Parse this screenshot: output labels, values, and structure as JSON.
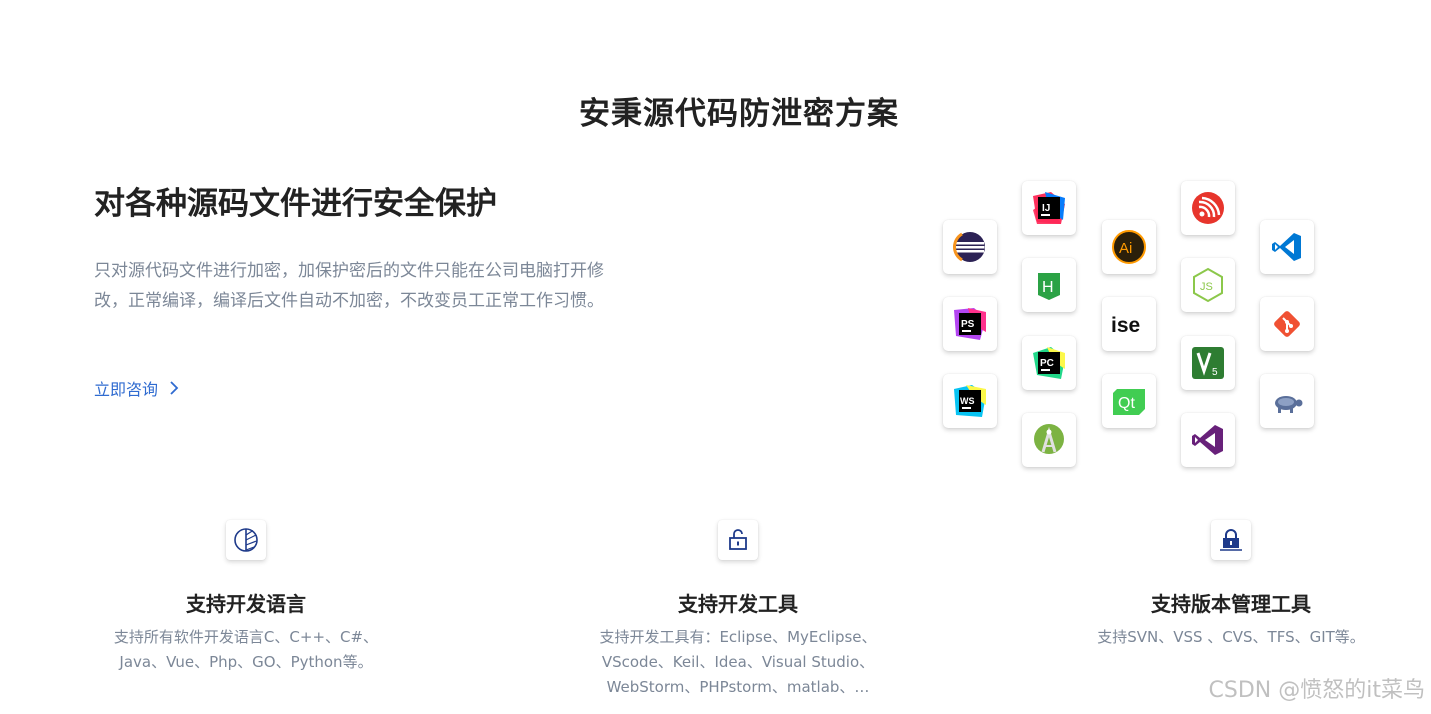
{
  "page": {
    "title": "安秉源代码防泄密方案"
  },
  "hero": {
    "heading": "对各种源码文件进行安全保护",
    "description": "只对源代码文件进行加密，加保护密后的文件只能在公司电脑打开修改，正常编译，编译后文件自动不加密，不改变员工正常工作习惯。",
    "consult_label": "立即咨询"
  },
  "tools": {
    "eclipse": {
      "icon": "eclipse-icon",
      "color": "#2c2255"
    },
    "intellij": {
      "icon": "intellij-idea-icon",
      "label": "IJ",
      "color": "#000000"
    },
    "illustrator": {
      "icon": "illustrator-icon",
      "label": "Ai",
      "color": "#ff9a00"
    },
    "espressif": {
      "icon": "espressif-icon",
      "color": "#e7352c"
    },
    "vscode": {
      "icon": "vscode-icon",
      "color": "#0078d4"
    },
    "hbuilder": {
      "icon": "hbuilder-icon",
      "label": "H",
      "color": "#2ba245"
    },
    "phpstorm": {
      "icon": "phpstorm-icon",
      "label": "PS",
      "color": "#b345f1"
    },
    "ise": {
      "icon": "ise-icon",
      "label": "ise",
      "color": "#111111"
    },
    "nodejs": {
      "icon": "nodejs-icon",
      "label": "JS",
      "color": "#8cc84b"
    },
    "git": {
      "icon": "git-icon",
      "color": "#f05133"
    },
    "pycharm": {
      "icon": "pycharm-icon",
      "label": "PC",
      "color": "#21d789"
    },
    "vivado": {
      "icon": "vivado-icon",
      "label": "5",
      "color": "#2e7d32"
    },
    "webstorm": {
      "icon": "webstorm-icon",
      "label": "WS",
      "color": "#07c3f2"
    },
    "qt": {
      "icon": "qt-icon",
      "label": "Qt",
      "color": "#41cd52"
    },
    "tortoise": {
      "icon": "tortoise-svn-icon",
      "color": "#5a6f9a"
    },
    "android_studio": {
      "icon": "android-studio-icon",
      "color": "#7cb342"
    },
    "visual_studio": {
      "icon": "visual-studio-icon",
      "color": "#68217a"
    }
  },
  "features": [
    {
      "icon": "pie-chart-icon",
      "title": "支持开发语言",
      "lines": [
        "支持所有软件开发语言C、C++、C#、",
        "Java、Vue、Php、GO、Python等。"
      ]
    },
    {
      "icon": "unlock-icon",
      "title": "支持开发工具",
      "lines": [
        "支持开发工具有：Eclipse、MyEclipse、",
        "VScode、Keil、Idea、Visual Studio、",
        "WebStorm、PHPstorm、matlab、…"
      ]
    },
    {
      "icon": "lock-icon",
      "title": "支持版本管理工具",
      "lines": [
        "支持SVN、VSS 、CVS、TFS、GIT等。"
      ]
    }
  ],
  "colors": {
    "accent": "#2f6bd0",
    "icon_blue": "#1e3a8a"
  },
  "watermark": "CSDN @愤怒的it菜鸟"
}
